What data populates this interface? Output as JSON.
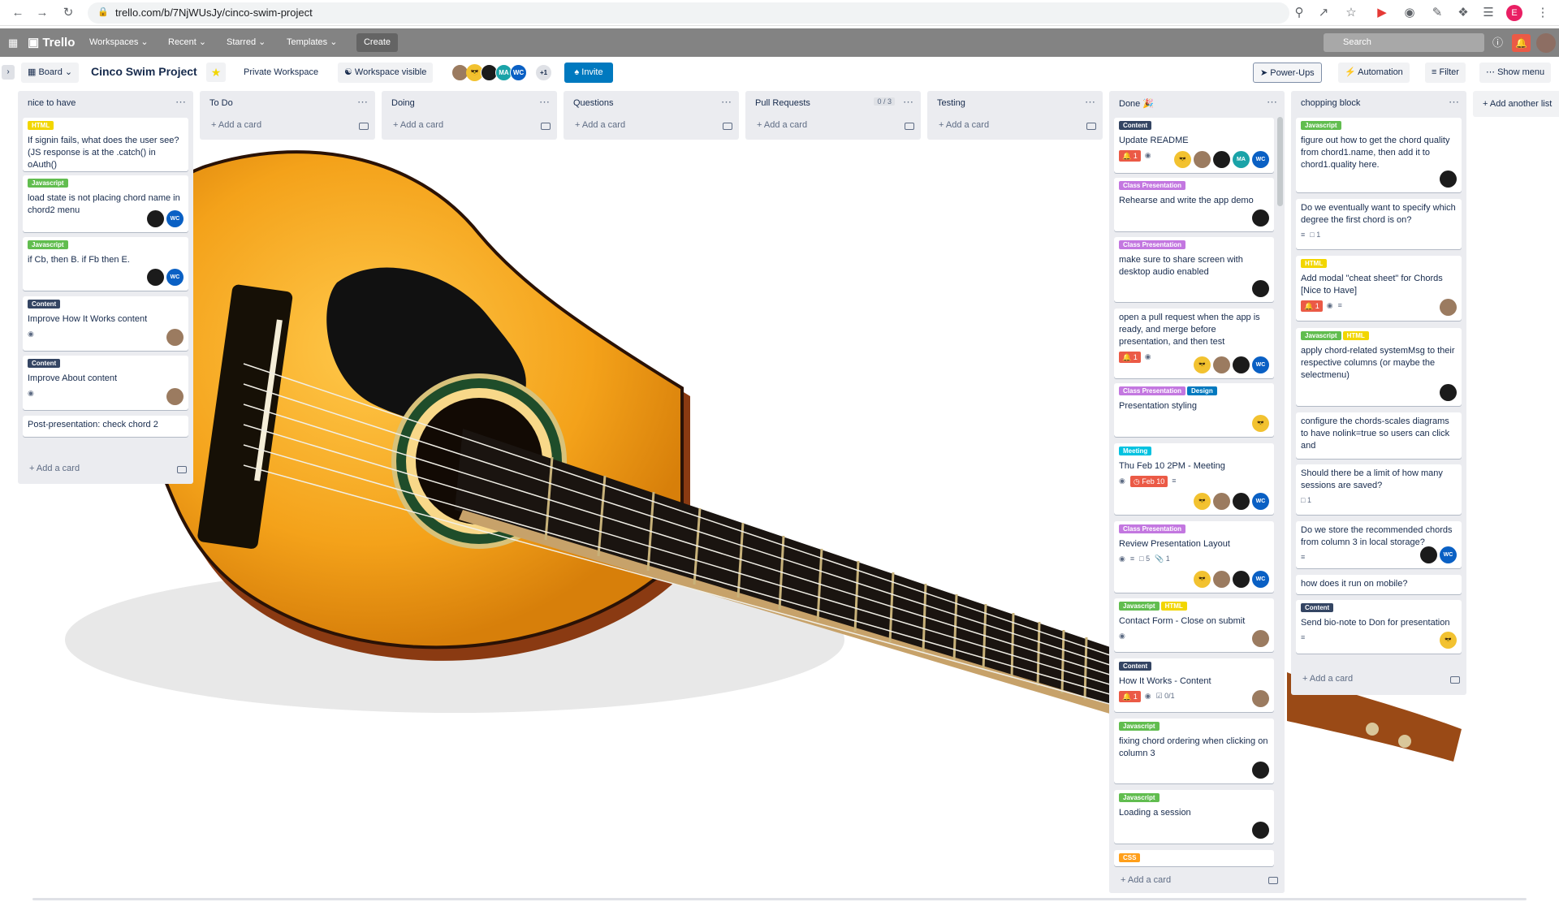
{
  "browser": {
    "url": "trello.com/b/7NjWUsJy/cinco-swim-project",
    "avatar_letter": "E"
  },
  "topnav": {
    "logo": "Trello",
    "workspaces": "Workspaces",
    "recent": "Recent",
    "starred": "Starred",
    "templates": "Templates",
    "create": "Create",
    "search_placeholder": "Search"
  },
  "board": {
    "view": "Board",
    "title": "Cinco Swim Project",
    "visibility_workspace": "Private Workspace",
    "workspace_visible": "Workspace visible",
    "members_more": "+1",
    "invite": "Invite",
    "powerups": "Power-Ups",
    "automation": "Automation",
    "filter": "Filter",
    "show_menu": "Show menu",
    "add_another_list": "Add another list"
  },
  "colors": {
    "green": "#61bd4f",
    "yellow": "#f2d600",
    "purple": "#c377e0",
    "navy": "#344563",
    "blue": "#0079bf",
    "sky": "#00c2e0",
    "orange": "#ff9f1a",
    "red": "#eb5a46"
  },
  "lists": [
    {
      "title": "nice to have",
      "add": "Add a card",
      "cards": [
        {
          "labels": [
            {
              "text": "HTML",
              "color": "#f2d600"
            }
          ],
          "text": "If signin fails, what does the user see? (JS response is at the .catch() in oAuth()"
        },
        {
          "labels": [
            {
              "text": "Javascript",
              "color": "#61bd4f"
            }
          ],
          "text": "load state is not placing chord name in chord2 menu"
        },
        {
          "labels": [
            {
              "text": "Javascript",
              "color": "#61bd4f"
            }
          ],
          "text": "if Cb, then B. if Fb then E."
        },
        {
          "labels": [
            {
              "text": "Content",
              "color": "#344563"
            }
          ],
          "text": "Improve How It Works content"
        },
        {
          "labels": [
            {
              "text": "Content",
              "color": "#344563"
            }
          ],
          "text": "Improve About content"
        },
        {
          "labels": [],
          "text": "Post-presentation: check chord 2"
        }
      ]
    },
    {
      "title": "To Do",
      "add": "Add a card",
      "cards": []
    },
    {
      "title": "Doing",
      "add": "Add a card",
      "cards": []
    },
    {
      "title": "Questions",
      "add": "Add a card",
      "cards": []
    },
    {
      "title": "Pull Requests",
      "limit": "0 / 3",
      "add": "Add a card",
      "cards": []
    },
    {
      "title": "Testing",
      "add": "Add a card",
      "cards": []
    },
    {
      "title": "Done 🎉",
      "add": "Add a card",
      "cards": [
        {
          "labels": [
            {
              "text": "Content",
              "color": "#344563"
            }
          ],
          "text": "Update README",
          "notif": "1"
        },
        {
          "labels": [
            {
              "text": "Class Presentation",
              "color": "#c377e0"
            }
          ],
          "text": "Rehearse and write the app demo"
        },
        {
          "labels": [
            {
              "text": "Class Presentation",
              "color": "#c377e0"
            }
          ],
          "text": "make sure to share screen with desktop audio enabled"
        },
        {
          "labels": [],
          "text": "open a pull request when the app is ready, and merge before presentation, and then test",
          "notif": "1"
        },
        {
          "labels": [
            {
              "text": "Class Presentation",
              "color": "#c377e0"
            },
            {
              "text": "Design",
              "color": "#0079bf"
            }
          ],
          "text": "Presentation styling"
        },
        {
          "labels": [
            {
              "text": "Meeting",
              "color": "#00c2e0"
            }
          ],
          "text": "Thu Feb 10 2PM - Meeting",
          "due": "Feb 10"
        },
        {
          "labels": [
            {
              "text": "Class Presentation",
              "color": "#c377e0"
            }
          ],
          "text": "Review Presentation Layout",
          "comments": "5",
          "attachments": "1"
        },
        {
          "labels": [
            {
              "text": "Javascript",
              "color": "#61bd4f"
            },
            {
              "text": "HTML",
              "color": "#f2d600"
            }
          ],
          "text": "Contact Form - Close on submit"
        },
        {
          "labels": [
            {
              "text": "Content",
              "color": "#344563"
            }
          ],
          "text": "How It Works - Content",
          "notif": "1",
          "checklist": "0/1"
        },
        {
          "labels": [
            {
              "text": "Javascript",
              "color": "#61bd4f"
            }
          ],
          "text": "fixing chord ordering when clicking on column 3"
        },
        {
          "labels": [
            {
              "text": "Javascript",
              "color": "#61bd4f"
            }
          ],
          "text": "Loading a session"
        },
        {
          "labels": [
            {
              "text": "CSS",
              "color": "#ff9f1a"
            }
          ],
          "text": ""
        }
      ]
    },
    {
      "title": "chopping block",
      "add": "Add a card",
      "cards": [
        {
          "labels": [
            {
              "text": "Javascript",
              "color": "#61bd4f"
            }
          ],
          "text": "figure out how to get the chord quality from chord1.name, then add it to chord1.quality here."
        },
        {
          "labels": [],
          "text": "Do we eventually want to specify which degree the first chord is on?",
          "comments": "1"
        },
        {
          "labels": [
            {
              "text": "HTML",
              "color": "#f2d600"
            }
          ],
          "text": "Add modal \"cheat sheet\" for Chords [Nice to Have]",
          "notif": "1"
        },
        {
          "labels": [
            {
              "text": "Javascript",
              "color": "#61bd4f"
            },
            {
              "text": "HTML",
              "color": "#f2d600"
            }
          ],
          "text": "apply chord-related systemMsg to their respective columns (or maybe the selectmenu)"
        },
        {
          "labels": [],
          "text": "configure the chords-scales diagrams to have nolink=true so users can click and"
        },
        {
          "labels": [],
          "text": "Should there be a limit of how many sessions are saved?",
          "comments": "1"
        },
        {
          "labels": [],
          "text": "Do we store the recommended chords from column 3 in local storage?"
        },
        {
          "labels": [],
          "text": "how does it run on mobile?"
        },
        {
          "labels": [
            {
              "text": "Content",
              "color": "#344563"
            }
          ],
          "text": "Send bio-note to Don for presentation"
        }
      ]
    }
  ]
}
